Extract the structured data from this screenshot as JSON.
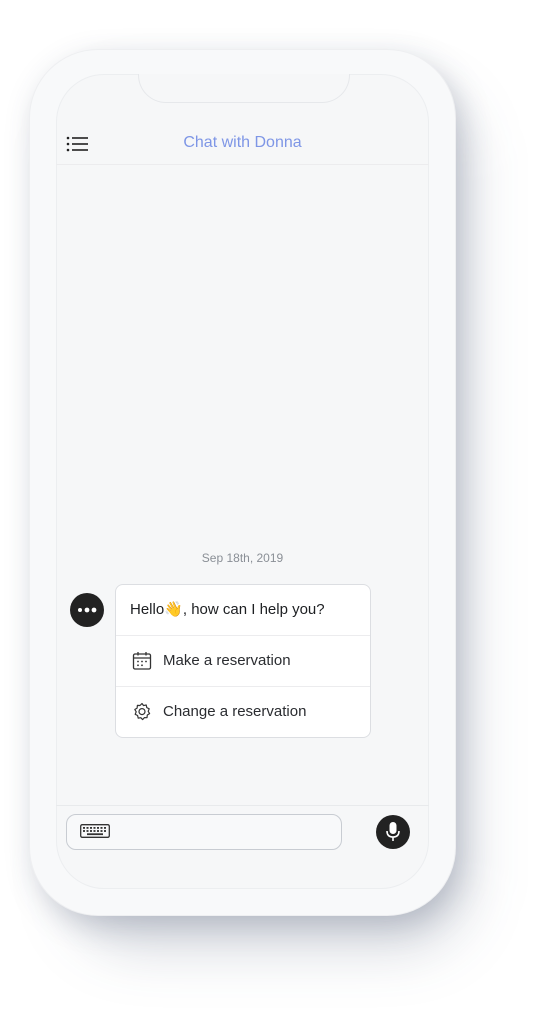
{
  "header": {
    "title": "Chat with Donna",
    "menu_icon": "menu-list-icon"
  },
  "chat": {
    "date": "Sep 18th, 2019",
    "greeting": "Hello👋, how can I help you?",
    "options": [
      {
        "label": "Make a reservation",
        "icon": "calendar-icon"
      },
      {
        "label": "Change a reservation",
        "icon": "gear-icon"
      }
    ]
  },
  "composer": {
    "input_value": "",
    "keyboard_icon": "keyboard-icon",
    "mic_icon": "microphone-icon"
  },
  "colors": {
    "title": "#7e96e6",
    "accent_dark": "#222222",
    "background": "#f6f7f8"
  }
}
